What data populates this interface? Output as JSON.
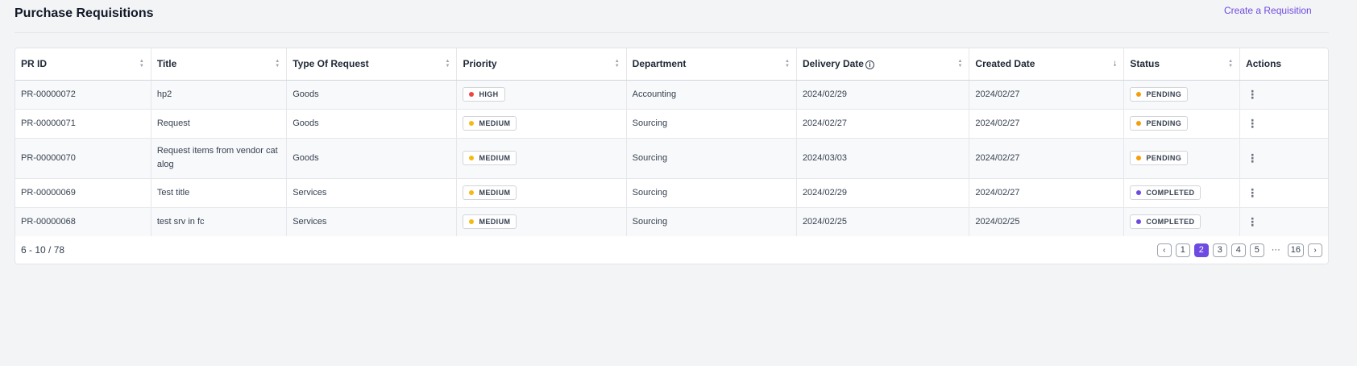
{
  "page": {
    "title": "Purchase Requisitions",
    "create_label": "Create a Requisition"
  },
  "table": {
    "columns": [
      {
        "label": "PR ID",
        "sort": "sortable"
      },
      {
        "label": "Title",
        "sort": "sortable"
      },
      {
        "label": "Type Of Request",
        "sort": "sortable"
      },
      {
        "label": "Priority",
        "sort": "sortable"
      },
      {
        "label": "Department",
        "sort": "sortable"
      },
      {
        "label": "Delivery Date",
        "sort": "sortable",
        "info": true
      },
      {
        "label": "Created Date",
        "sort": "descending"
      },
      {
        "label": "Status",
        "sort": "sortable"
      },
      {
        "label": "Actions",
        "sort": "none"
      }
    ],
    "rows": [
      {
        "pr_id": "PR-00000072",
        "title": "hp2",
        "type": "Goods",
        "priority": "HIGH",
        "department": "Accounting",
        "delivery_date": "2024/02/29",
        "created_date": "2024/02/27",
        "status": "PENDING"
      },
      {
        "pr_id": "PR-00000071",
        "title": "Request",
        "type": "Goods",
        "priority": "MEDIUM",
        "department": "Sourcing",
        "delivery_date": "2024/02/27",
        "created_date": "2024/02/27",
        "status": "PENDING"
      },
      {
        "pr_id": "PR-00000070",
        "title": "Request items from vendor catalog",
        "type": "Goods",
        "priority": "MEDIUM",
        "department": "Sourcing",
        "delivery_date": "2024/03/03",
        "created_date": "2024/02/27",
        "status": "PENDING"
      },
      {
        "pr_id": "PR-00000069",
        "title": "Test title",
        "type": "Services",
        "priority": "MEDIUM",
        "department": "Sourcing",
        "delivery_date": "2024/02/29",
        "created_date": "2024/02/27",
        "status": "COMPLETED"
      },
      {
        "pr_id": "PR-00000068",
        "title": "test srv in fc",
        "type": "Services",
        "priority": "MEDIUM",
        "department": "Sourcing",
        "delivery_date": "2024/02/25",
        "created_date": "2024/02/25",
        "status": "COMPLETED"
      }
    ]
  },
  "colors": {
    "accent": "#6d4be0",
    "priority_high": "#ef4444",
    "priority_medium": "#f5b914",
    "status_pending": "#f59e0b",
    "status_completed": "#6d4be0"
  },
  "icons": {
    "sort": "up-down-arrows-icon",
    "sort_desc": "arrow-down-icon",
    "info": "info-circle-icon",
    "actions": "kebab-menu-icon",
    "prev": "chevron-left-icon",
    "next": "chevron-right-icon"
  },
  "pagination": {
    "range_text": "6 - 10 / 78",
    "pages": [
      "1",
      "2",
      "3",
      "4",
      "5"
    ],
    "current": "2",
    "ellipsis": "···",
    "last": "16",
    "prev_symbol": "‹",
    "next_symbol": "›"
  }
}
